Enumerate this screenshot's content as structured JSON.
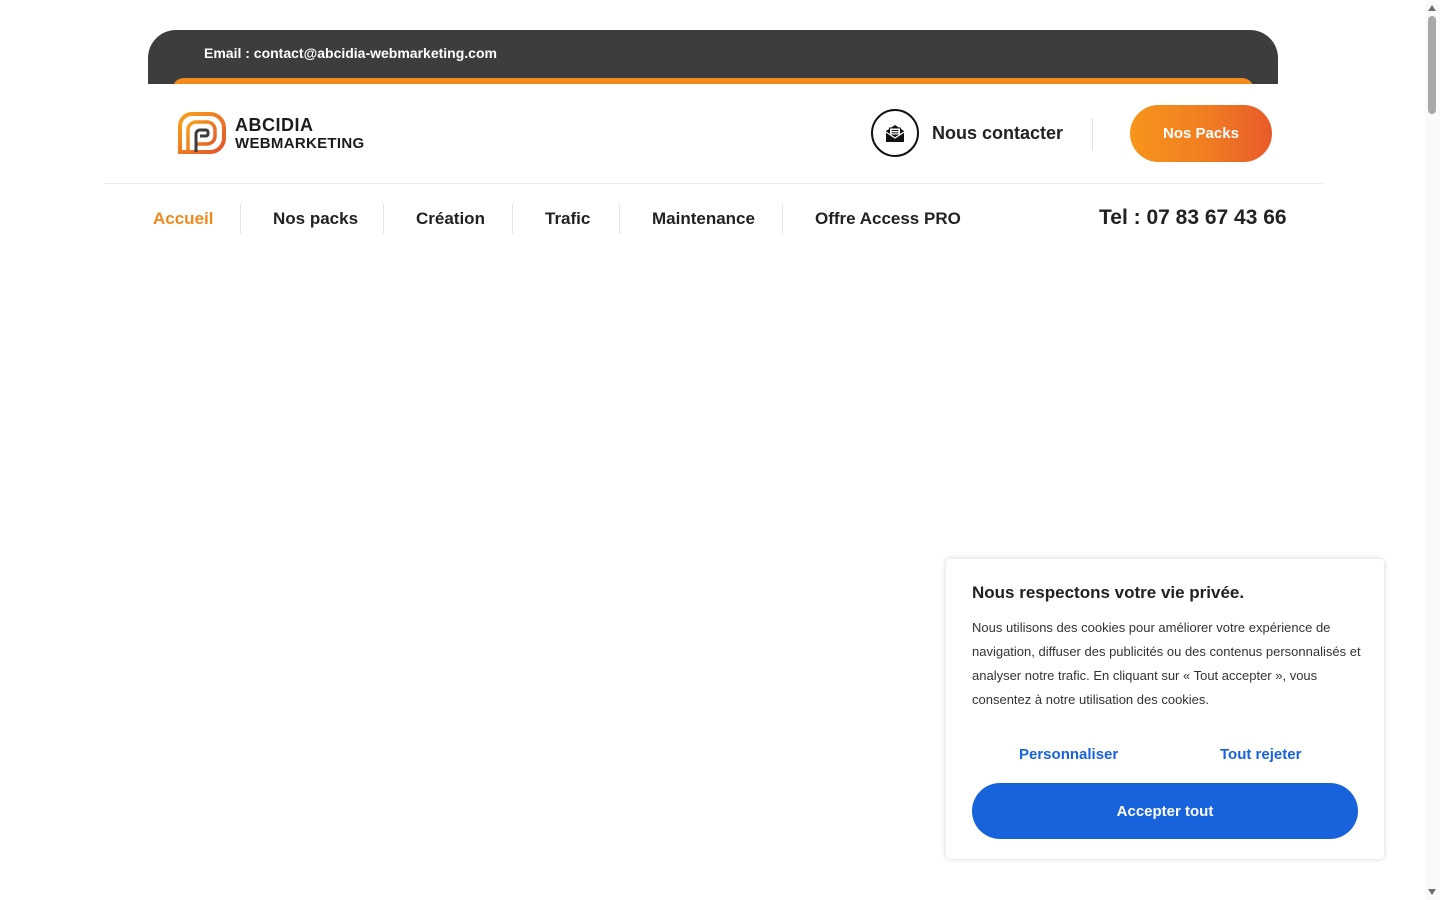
{
  "topbar": {
    "email": "Email : contact@abcidia-webmarketing.com"
  },
  "header": {
    "logo_line1": "ABCIDIA",
    "logo_line2": "WEBMARKETING",
    "contact_label": "Nous contacter",
    "packs_button": "Nos Packs"
  },
  "nav": {
    "items": [
      {
        "label": "Accueil",
        "active": true
      },
      {
        "label": "Nos packs",
        "active": false
      },
      {
        "label": "Création",
        "active": false
      },
      {
        "label": "Trafic",
        "active": false
      },
      {
        "label": "Maintenance",
        "active": false
      },
      {
        "label": "Offre Access PRO",
        "active": false
      }
    ],
    "phone": "Tel : 07 83 67 43 66"
  },
  "cookie": {
    "title": "Nous respectons votre vie privée.",
    "text": "Nous utilisons des cookies pour améliorer votre expérience de navigation, diffuser des publicités ou des contenus personnalisés et analyser notre trafic. En cliquant sur « Tout accepter », vous consentez à notre utilisation des cookies.",
    "customize": "Personnaliser",
    "reject": "Tout rejeter",
    "accept": "Accepter tout"
  },
  "colors": {
    "accent_orange": "#f08a1c",
    "dark_bar": "#3d3d3f",
    "cookie_blue": "#1863dc"
  },
  "icons": [
    "logo-mark-icon",
    "envelope-icon",
    "scroll-up-arrow-icon",
    "scroll-down-arrow-icon"
  ]
}
